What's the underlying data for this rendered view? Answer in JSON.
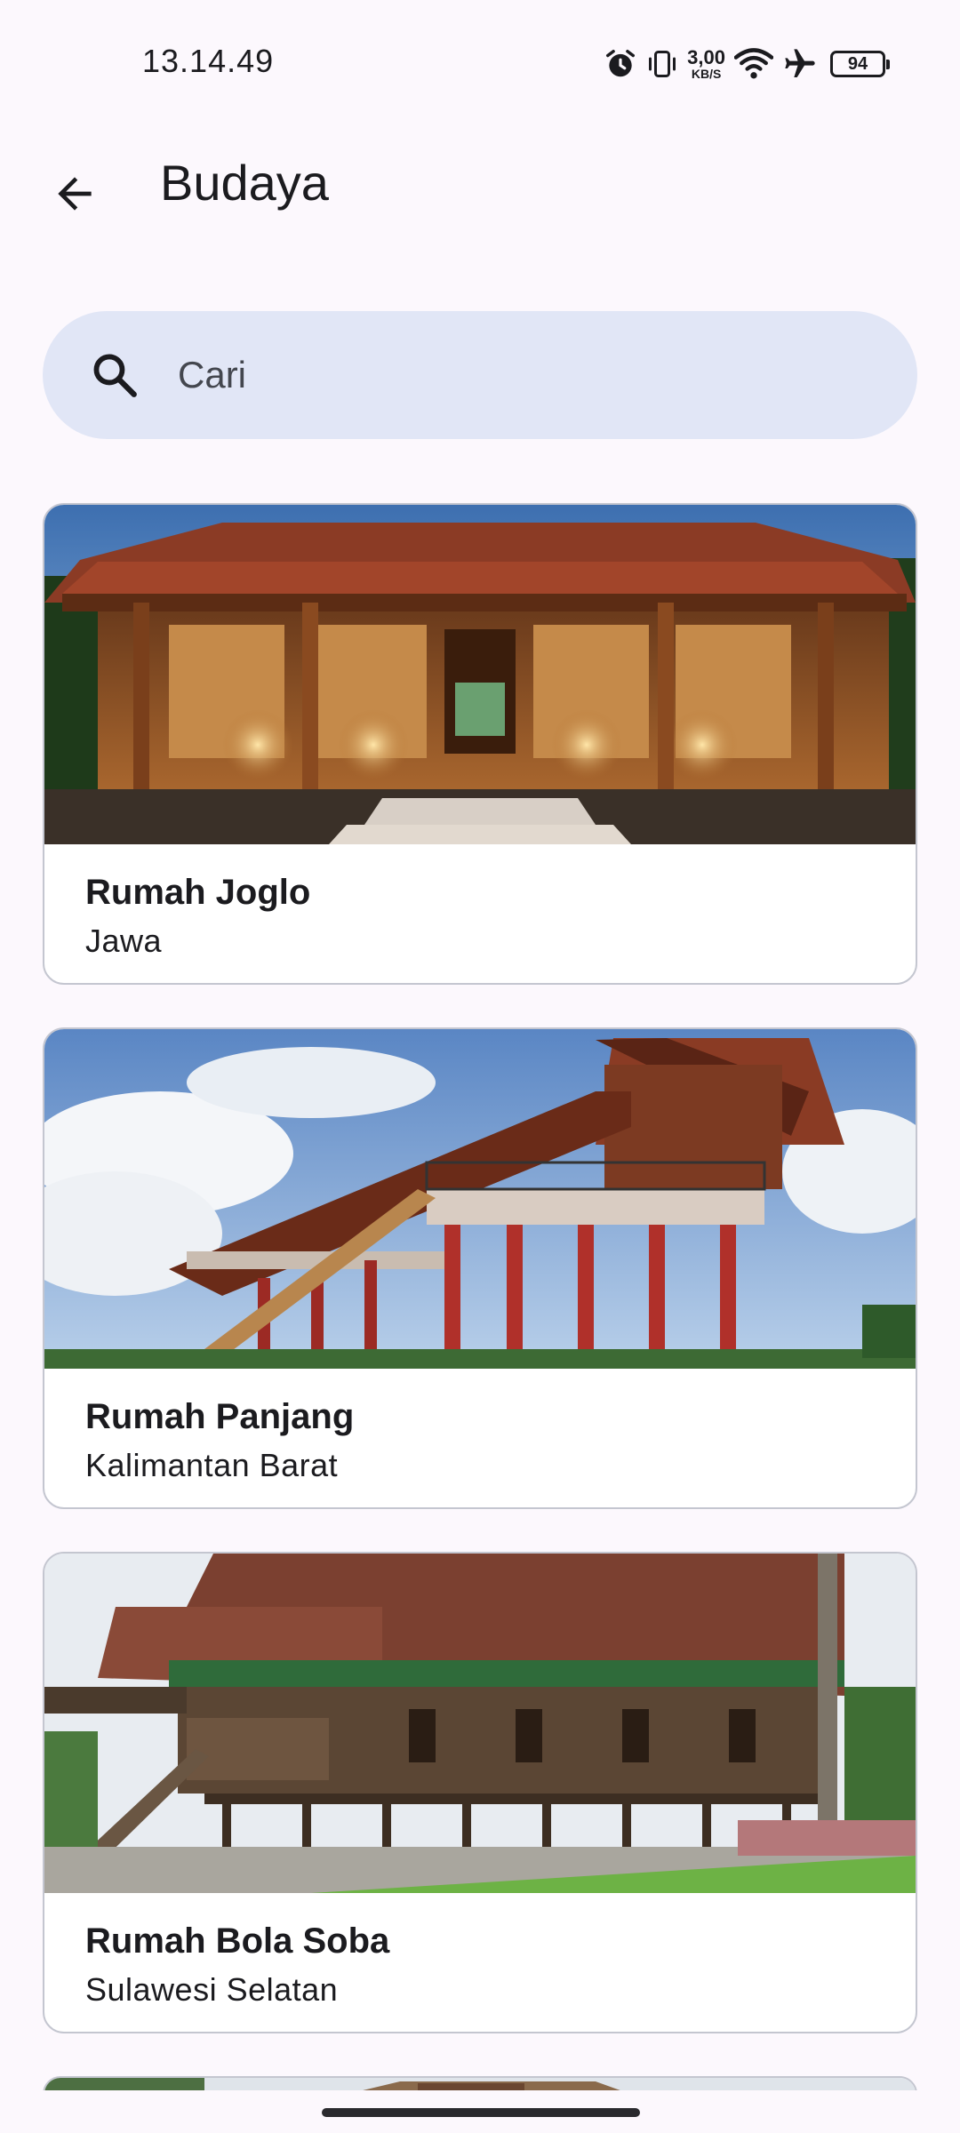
{
  "status_bar": {
    "time": "13.14.49",
    "net_speed_value": "3,00",
    "net_speed_unit": "KB/S",
    "battery_level": "94",
    "icons": [
      "alarm-icon",
      "vibrate-icon",
      "wifi-icon",
      "airplane-mode-icon",
      "battery-icon"
    ]
  },
  "app_bar": {
    "back_icon": "arrow-back-icon",
    "title": "Budaya"
  },
  "search": {
    "icon": "search-icon",
    "placeholder": "Cari",
    "value": ""
  },
  "cards": [
    {
      "title": "Rumah Joglo",
      "subtitle": "Jawa",
      "image": "rumah-joglo-photo"
    },
    {
      "title": "Rumah Panjang",
      "subtitle": "Kalimantan Barat",
      "image": "rumah-panjang-photo"
    },
    {
      "title": "Rumah Bola Soba",
      "subtitle": "Sulawesi Selatan",
      "image": "rumah-bola-soba-photo"
    },
    {
      "title": "",
      "subtitle": "",
      "image": "partial-card-photo"
    }
  ],
  "colors": {
    "background": "#fcf8fd",
    "search_bg": "#e1e6f6",
    "card_border": "#c4c6d0",
    "text_primary": "#1b1b1f"
  }
}
